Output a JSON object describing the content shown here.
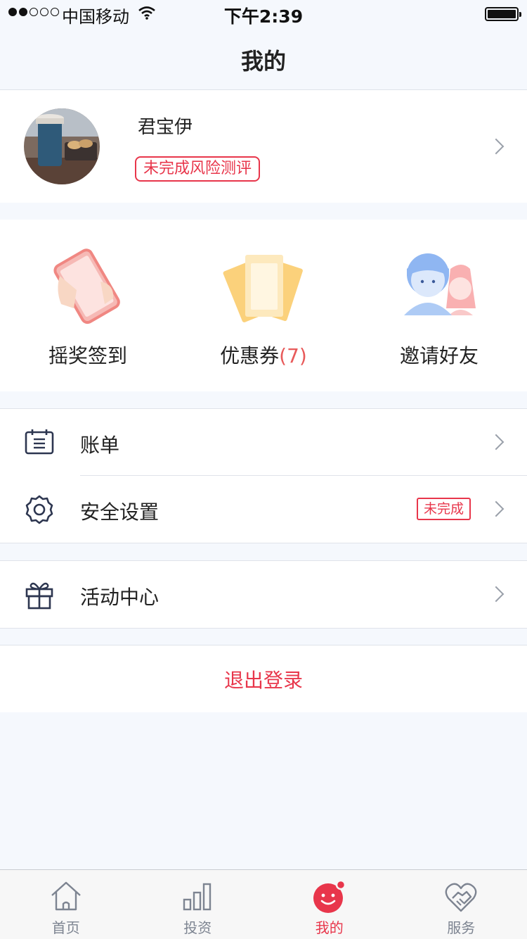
{
  "status_bar": {
    "carrier": "中国移动",
    "time": "下午2:39"
  },
  "header": {
    "title": "我的"
  },
  "profile": {
    "name": "君宝伊",
    "risk_badge": "未完成风险测评"
  },
  "actions": [
    {
      "label": "摇奖签到",
      "icon": "phone-shake-icon"
    },
    {
      "label": "优惠券",
      "count": "(7)",
      "icon": "coupon-icon"
    },
    {
      "label": "邀请好友",
      "icon": "friends-icon"
    }
  ],
  "menu": {
    "bill": {
      "label": "账单",
      "icon": "calendar-bill-icon"
    },
    "security": {
      "label": "安全设置",
      "badge": "未完成",
      "icon": "gear-icon"
    },
    "activity": {
      "label": "活动中心",
      "icon": "gift-icon"
    }
  },
  "logout": "退出登录",
  "tabbar": {
    "tabs": [
      {
        "label": "首页",
        "icon": "home-icon"
      },
      {
        "label": "投资",
        "icon": "bar-chart-icon"
      },
      {
        "label": "我的",
        "icon": "smiley-icon",
        "active": true
      },
      {
        "label": "服务",
        "icon": "handshake-heart-icon"
      }
    ]
  },
  "colors": {
    "accent": "#e8364b",
    "background": "#f5f8fd",
    "icon_stroke": "#2d3650"
  }
}
